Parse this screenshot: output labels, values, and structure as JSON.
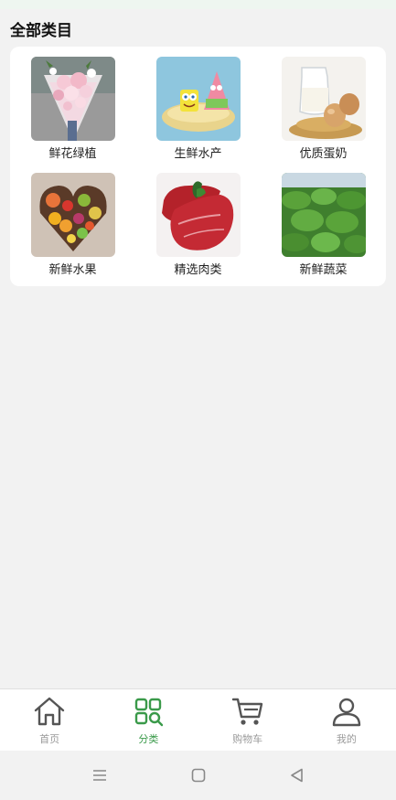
{
  "header": {
    "title": "全部类目"
  },
  "categories": [
    {
      "label": "鲜花绿植",
      "icon": "flower-bouquet-image"
    },
    {
      "label": "生鲜水产",
      "icon": "seafood-cartoon-image"
    },
    {
      "label": "优质蛋奶",
      "icon": "milk-eggs-image"
    },
    {
      "label": "新鲜水果",
      "icon": "fruit-flower-box-image"
    },
    {
      "label": "精选肉类",
      "icon": "meat-image"
    },
    {
      "label": "新鲜蔬菜",
      "icon": "vegetables-image"
    }
  ],
  "tabbar": {
    "active": "分类",
    "accent_color": "#3a9a4a",
    "items": [
      {
        "label": "首页",
        "icon": "home-icon"
      },
      {
        "label": "分类",
        "icon": "category-icon"
      },
      {
        "label": "购物车",
        "icon": "cart-icon"
      },
      {
        "label": "我的",
        "icon": "user-icon"
      }
    ]
  },
  "system_nav": {
    "items": [
      "menu-icon",
      "home-square-icon",
      "back-triangle-icon"
    ]
  }
}
